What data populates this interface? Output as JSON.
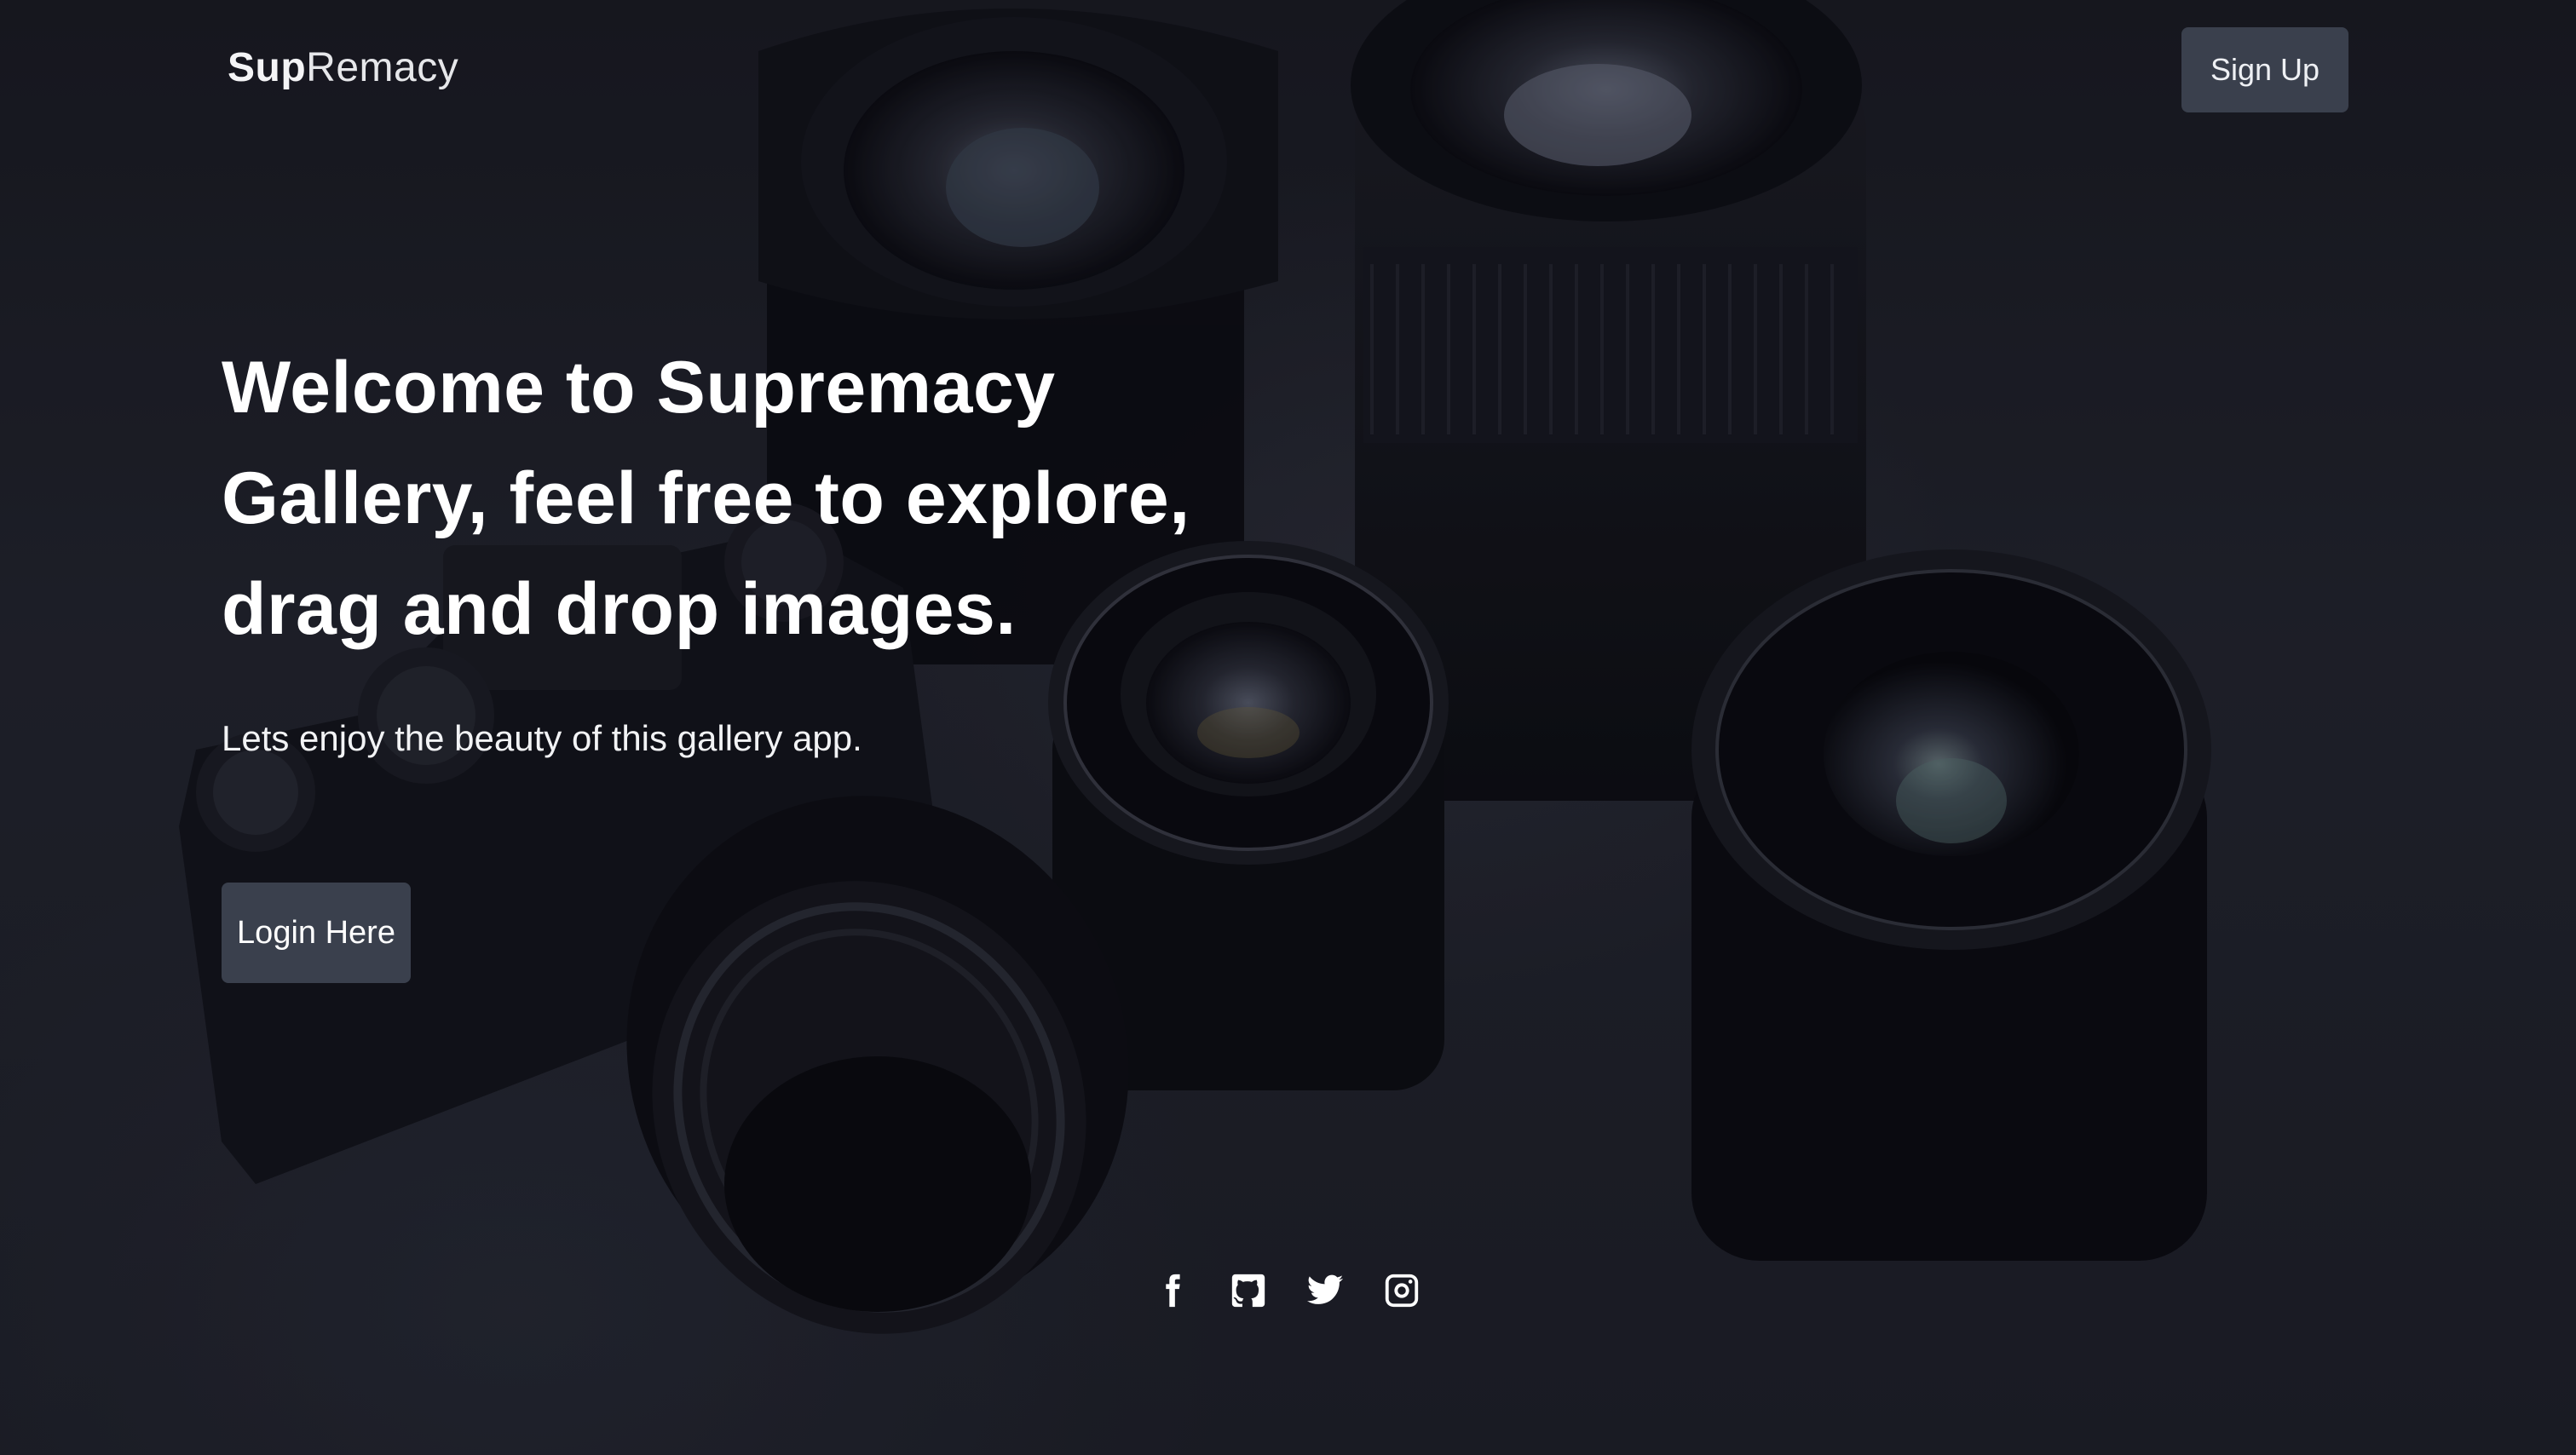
{
  "header": {
    "logo_bold": "Sup",
    "logo_light": "Remacy",
    "signup_label": "Sign Up"
  },
  "hero": {
    "title": "Welcome to Supremacy Gallery, feel free to explore, drag and drop images.",
    "subtitle": "Lets enjoy the beauty of this gallery app.",
    "login_label": "Login Here"
  },
  "social": {
    "icons": [
      "facebook-icon",
      "github-icon",
      "twitter-icon",
      "instagram-icon"
    ]
  },
  "colors": {
    "button_bg": "#3a404d",
    "text": "#ffffff",
    "background": "#1e2028"
  }
}
